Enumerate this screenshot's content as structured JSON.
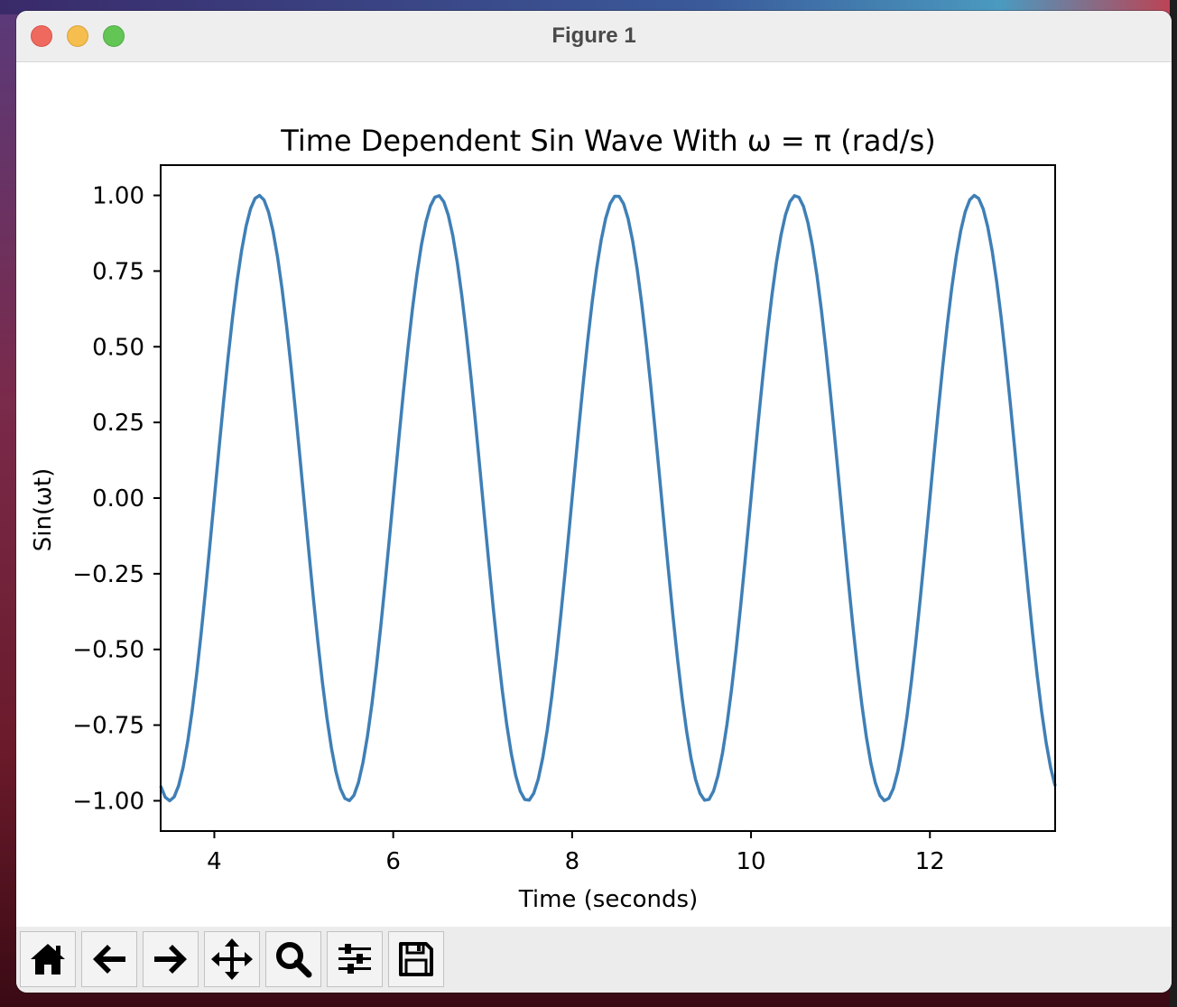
{
  "window": {
    "title": "Figure 1"
  },
  "toolbar": {
    "buttons": [
      {
        "name": "home",
        "icon": "home-icon"
      },
      {
        "name": "back",
        "icon": "arrow-left-icon"
      },
      {
        "name": "forward",
        "icon": "arrow-right-icon"
      },
      {
        "name": "pan",
        "icon": "move-arrows-icon"
      },
      {
        "name": "zoom",
        "icon": "magnifier-icon"
      },
      {
        "name": "configure",
        "icon": "sliders-icon"
      },
      {
        "name": "save",
        "icon": "floppy-disk-icon"
      }
    ]
  },
  "colors": {
    "line": "#3f7fb6",
    "axes": "#000000",
    "background": "#ffffff",
    "titlebar": "#efeeef",
    "toolbar": "#ececec"
  },
  "chart_data": {
    "type": "line",
    "title": "Time Dependent Sin Wave With ω = π (rad/s)",
    "xlabel": "Time (seconds)",
    "ylabel": "Sin(ωt)",
    "xlim": [
      3.4,
      13.4
    ],
    "ylim": [
      -1.1,
      1.1
    ],
    "xticks": [
      4,
      6,
      8,
      10,
      12
    ],
    "xtick_labels": [
      "4",
      "6",
      "8",
      "10",
      "12"
    ],
    "yticks": [
      1.0,
      0.75,
      0.5,
      0.25,
      0.0,
      -0.25,
      -0.5,
      -0.75,
      -1.0
    ],
    "ytick_labels": [
      "1.00",
      "0.75",
      "0.50",
      "0.25",
      "0.00",
      "−0.25",
      "−0.50",
      "−0.75",
      "−1.00"
    ],
    "grid": false,
    "series": [
      {
        "function": "sin(pi * t)",
        "omega": 3.14159265,
        "t_start": 3.4,
        "t_end": 13.4,
        "samples": 200
      }
    ]
  }
}
